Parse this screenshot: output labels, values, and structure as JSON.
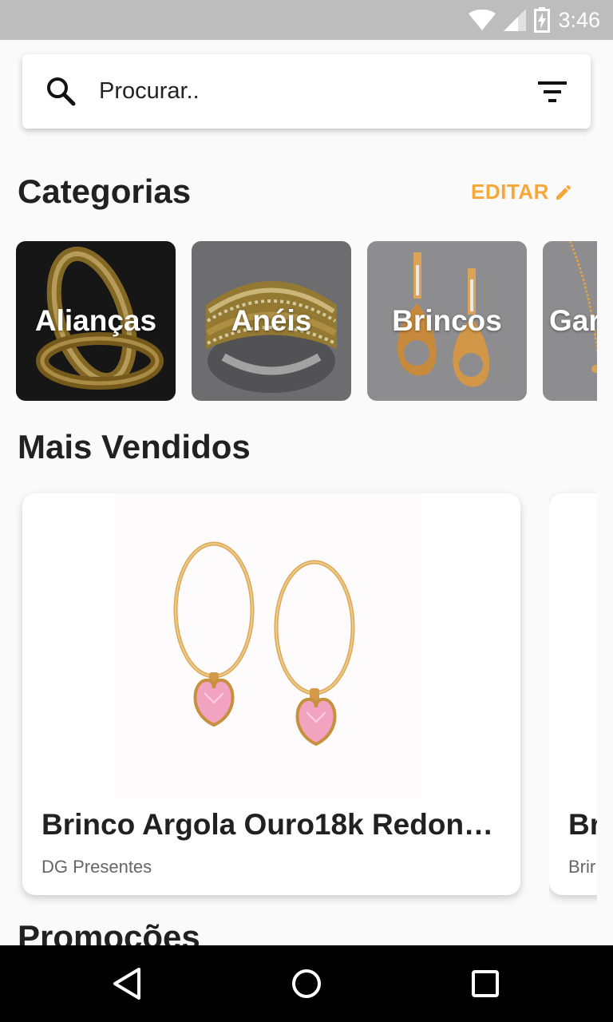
{
  "status_bar": {
    "time": "3:46",
    "icons": [
      "wifi-icon",
      "signal-icon",
      "battery-charging-icon"
    ]
  },
  "search": {
    "placeholder": "Procurar..",
    "value": "",
    "icons": [
      "search-icon",
      "filter-icon"
    ]
  },
  "categories_section": {
    "title": "Categorias",
    "edit_label": "EDITAR"
  },
  "categories": [
    {
      "label": "Alianças"
    },
    {
      "label": "Anéis"
    },
    {
      "label": "Brincos"
    },
    {
      "label": "Gar"
    }
  ],
  "best_sellers": {
    "title": "Mais Vendidos"
  },
  "products": [
    {
      "title": "Brinco Argola Ouro18k Redon…",
      "store": "DG Presentes"
    },
    {
      "title": "Br",
      "store": "Brir"
    }
  ],
  "promotions": {
    "title": "Promoções"
  },
  "nav_bar": {
    "buttons": [
      "back-icon",
      "home-icon",
      "recents-icon"
    ]
  },
  "colors": {
    "accent": "#f6a737",
    "status_bar": "#bdbdbd",
    "background": "#fafafa"
  }
}
